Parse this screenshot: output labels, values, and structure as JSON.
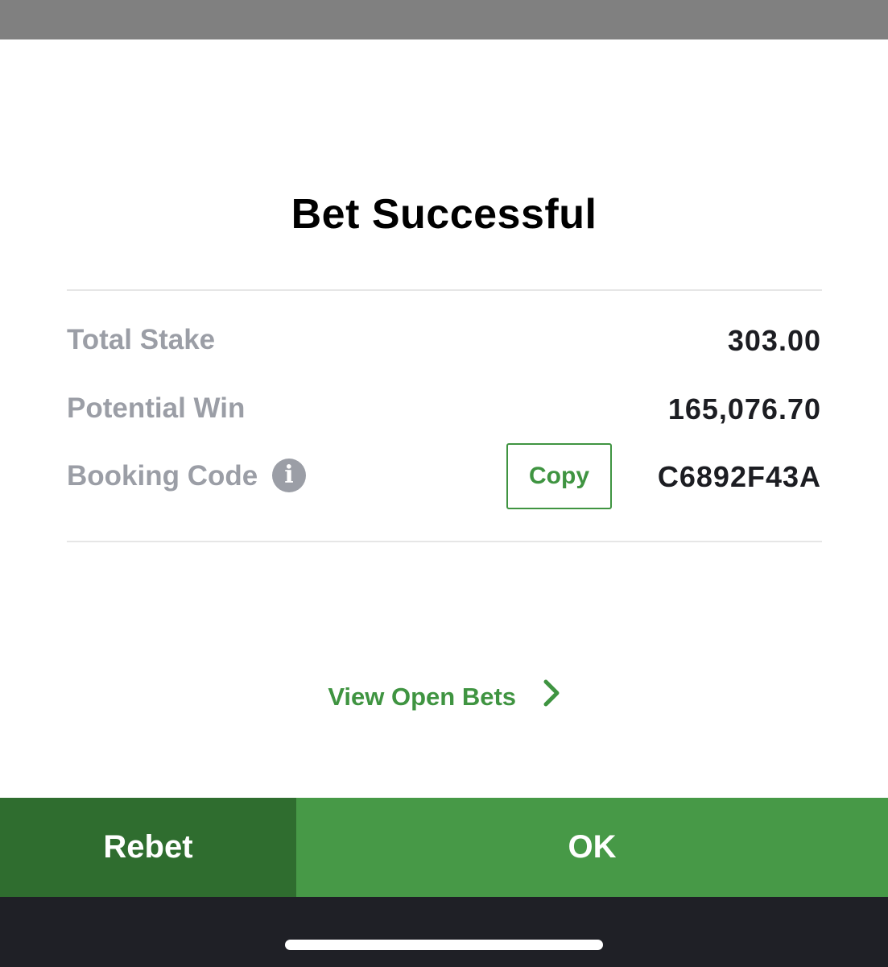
{
  "dialog": {
    "title": "Bet Successful",
    "rows": [
      {
        "label": "Total Stake",
        "value": "303.00"
      },
      {
        "label": "Potential Win",
        "value": "165,076.70"
      },
      {
        "label": "Booking Code",
        "value": "C6892F43A"
      }
    ],
    "info_icon": {
      "glyph": "i",
      "name": "info-icon"
    },
    "copy_label": "Copy",
    "view_open_bets_label": "View Open Bets",
    "chevron_icon": "chevron-right-icon"
  },
  "footer": {
    "rebet_label": "Rebet",
    "ok_label": "OK"
  },
  "colors": {
    "accent_green": "#3f9441",
    "rebet_green": "#2f6d2f",
    "ok_green": "#479947",
    "label_gray": "#9b9ea6",
    "value_dark": "#1c1d22"
  }
}
